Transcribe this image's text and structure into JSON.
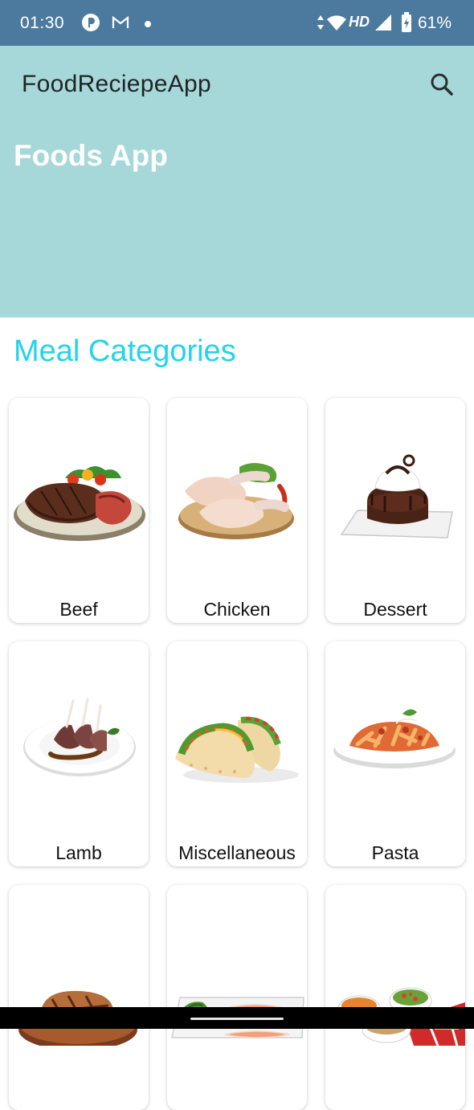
{
  "status_bar": {
    "time": "01:30",
    "network_type": "HD",
    "battery_percent": "61%",
    "icons": [
      "app-notification-icon",
      "gmail-icon",
      "dot-icon",
      "data-arrows-icon",
      "wifi-icon",
      "signal-icon",
      "battery-charging-icon"
    ]
  },
  "app_bar": {
    "title": "FoodReciepeApp",
    "search_icon": "search-icon"
  },
  "header": {
    "heading": "Foods App",
    "background": "#a6d8d9"
  },
  "section": {
    "title": "Meal Categories",
    "color": "#22d3ec"
  },
  "categories": [
    {
      "label": "Beef"
    },
    {
      "label": "Chicken"
    },
    {
      "label": "Dessert"
    },
    {
      "label": "Lamb"
    },
    {
      "label": "Miscellaneous"
    },
    {
      "label": "Pasta"
    },
    {
      "label": ""
    },
    {
      "label": ""
    },
    {
      "label": ""
    }
  ],
  "colors": {
    "status_bar": "#4b7a9e",
    "title_text": "#1f2326"
  }
}
